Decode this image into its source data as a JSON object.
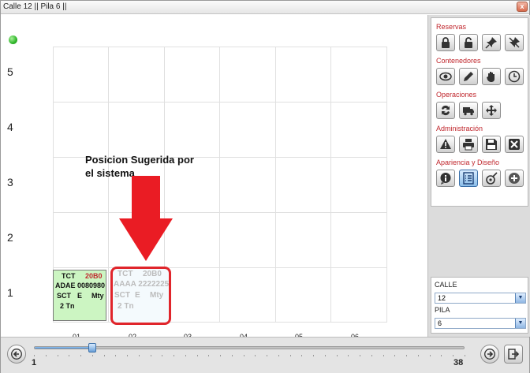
{
  "window": {
    "title": "Calle 12 || Pila 6 ||",
    "close_label": "x"
  },
  "grid": {
    "y_labels": [
      "5",
      "4",
      "3",
      "2",
      "1"
    ],
    "x_labels": [
      "01",
      "02",
      "03",
      "04",
      "05",
      "06"
    ]
  },
  "container_placed": {
    "line1_left": "TCT",
    "line1_right": "20B0",
    "line2": "ADAE 0080980",
    "line3_a": "SCT",
    "line3_b": "E",
    "line3_c": "Mty",
    "line4": "2 Tn",
    "colors": {
      "background": "#ccf5c2",
      "size_code": "#c0272d"
    }
  },
  "container_suggested": {
    "line1_left": "TCT",
    "line1_right": "20B0",
    "line2": "AAAA 2222225",
    "line3_a": "SCT",
    "line3_b": "E",
    "line3_c": "Mty",
    "line4": "2 Tn",
    "colors": {
      "border": "#e0252b",
      "text": "#bcbcbc"
    }
  },
  "annotation": {
    "text": "Posicion Sugerida por el sistema",
    "arrow_color": "#ea1c24"
  },
  "sidebar": {
    "sections": [
      {
        "title": "Reservas",
        "buttons": [
          "lock-icon",
          "unlock-icon",
          "pin-icon",
          "unpin-icon"
        ]
      },
      {
        "title": "Contenedores",
        "buttons": [
          "eye-icon",
          "pencil-icon",
          "hand-icon",
          "clock-icon"
        ]
      },
      {
        "title": "Operaciones",
        "buttons": [
          "swap-icon",
          "truck-icon",
          "move-icon"
        ]
      },
      {
        "title": "Administración",
        "buttons": [
          "warning-icon",
          "printer-icon",
          "save-icon",
          "close-icon"
        ]
      },
      {
        "title": "Apariencia y Diseño",
        "buttons": [
          "info-bubble-icon",
          "list-icon",
          "tag-icon",
          "plus-icon"
        ]
      }
    ],
    "calle_label": "CALLE",
    "calle_value": "12",
    "pila_label": "PILA",
    "pila_value": "6"
  },
  "navigator": {
    "min_label": "1",
    "max_label": "38",
    "current": 6,
    "min": 1,
    "max": 38
  },
  "colors": {
    "section_title": "#c0272d",
    "status_dot": "#2fb52a",
    "accent": "#4a88cc"
  }
}
